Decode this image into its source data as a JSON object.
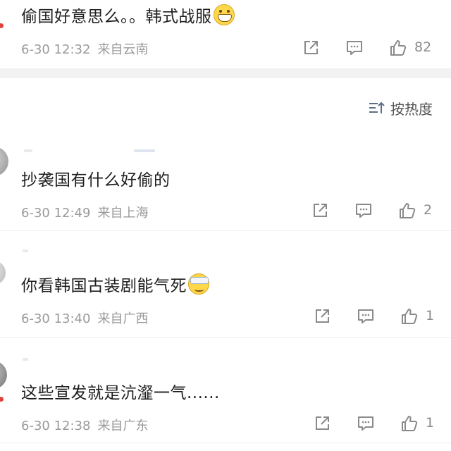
{
  "comments": [
    {
      "text": "偷国好意思么。。韩式战服",
      "emoji": "grinning-emoji",
      "date": "6-30 12:32",
      "location": "来自云南",
      "likes": "82"
    },
    {
      "text": "抄袭国有什么好偷的",
      "emoji": "",
      "date": "6-30 12:49",
      "location": "来自上海",
      "likes": "2"
    },
    {
      "text": "你看韩国古装剧能气死",
      "emoji": "sick-face-emoji",
      "date": "6-30 13:40",
      "location": "来自广西",
      "likes": "1"
    },
    {
      "text": "这些宣发就是沆瀣一气......",
      "emoji": "",
      "date": "6-30 12:38",
      "location": "来自广东",
      "likes": "1"
    }
  ],
  "sort": {
    "label": "按热度",
    "icon": "sort-icon"
  },
  "action_icons": [
    "share-icon",
    "comment-icon",
    "like-icon"
  ],
  "colors": {
    "meta_text": "#9a9a9a",
    "badge": "#e2413b",
    "section_gap": "#f2f2f2"
  }
}
